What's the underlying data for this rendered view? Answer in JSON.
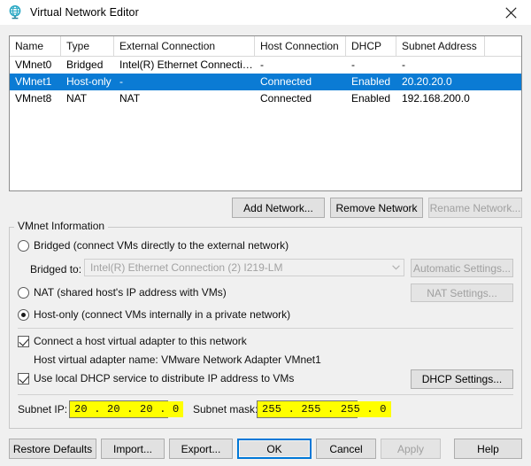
{
  "window": {
    "title": "Virtual Network Editor",
    "icon": "globe-icon",
    "close_label": "✕"
  },
  "table": {
    "columns": [
      "Name",
      "Type",
      "External Connection",
      "Host Connection",
      "DHCP",
      "Subnet Address"
    ],
    "rows": [
      {
        "selected": false,
        "cells": [
          "VMnet0",
          "Bridged",
          "Intel(R) Ethernet Connectio...",
          "-",
          "-",
          "-"
        ]
      },
      {
        "selected": true,
        "cells": [
          "VMnet1",
          "Host-only",
          "-",
          "Connected",
          "Enabled",
          "20.20.20.0"
        ]
      },
      {
        "selected": false,
        "cells": [
          "VMnet8",
          "NAT",
          "NAT",
          "Connected",
          "Enabled",
          "192.168.200.0"
        ]
      }
    ]
  },
  "network_buttons": {
    "add": "Add Network...",
    "remove": "Remove Network",
    "rename": "Rename Network..."
  },
  "vmnet_info": {
    "group_title": "VMnet Information",
    "bridged": {
      "label": "Bridged (connect VMs directly to the external network)",
      "selected": false,
      "bridged_to_label": "Bridged to:",
      "bridged_to_value": "Intel(R) Ethernet Connection (2) I219-LM",
      "automatic_settings": "Automatic Settings..."
    },
    "nat": {
      "label": "NAT (shared host's IP address with VMs)",
      "selected": false,
      "nat_settings": "NAT Settings..."
    },
    "hostonly": {
      "label": "Host-only (connect VMs internally in a private network)",
      "selected": true
    },
    "connect_adapter": {
      "label": "Connect a host virtual adapter to this network",
      "checked": true
    },
    "adapter_name": "Host virtual adapter name: VMware Network Adapter VMnet1",
    "local_dhcp": {
      "label": "Use local DHCP service to distribute IP address to VMs",
      "checked": true,
      "dhcp_settings": "DHCP Settings..."
    },
    "subnet_ip": {
      "label": "Subnet IP:",
      "value": "20 . 20 . 20 .  0"
    },
    "subnet_mask": {
      "label": "Subnet mask:",
      "value": "255 . 255 . 255 .  0"
    }
  },
  "footer": {
    "restore_defaults": "Restore Defaults",
    "import": "Import...",
    "export": "Export...",
    "ok": "OK",
    "cancel": "Cancel",
    "apply": "Apply",
    "help": "Help"
  },
  "colors": {
    "selection_blue": "#0B7BD4",
    "focus_blue": "#0078D7",
    "highlight_yellow": "#FFFF00",
    "window_bg": "#F0F0F0"
  }
}
